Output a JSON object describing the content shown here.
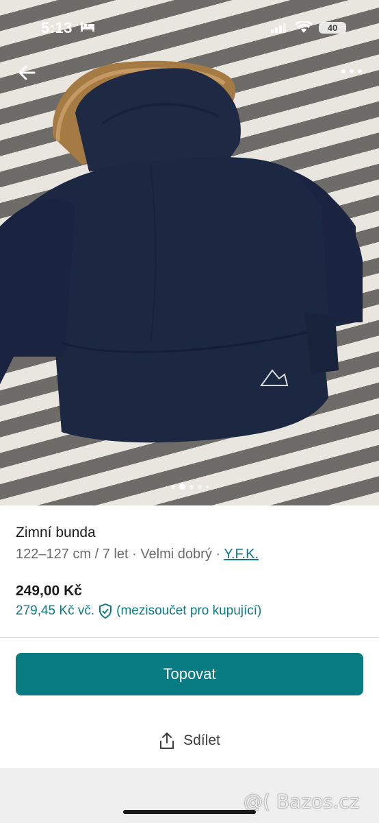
{
  "status_bar": {
    "time": "5:13",
    "battery": "40"
  },
  "photo": {
    "carousel_total": 5,
    "carousel_active_index": 1,
    "description_icon": "jacket-photo"
  },
  "listing": {
    "title": "Zimní bunda",
    "meta": "122–127 cm / 7 let · Velmi dobrý · ",
    "brand": "Y.F.K.",
    "price": "249,00 Kč",
    "price_total": "279,45 Kč vč.",
    "price_total_note": "(mezisoučet pro kupující)"
  },
  "actions": {
    "primary_label": "Topovat",
    "share_label": "Sdílet"
  },
  "watermark": "@( Bazos.cz",
  "colors": {
    "accent": "#087c82",
    "link": "#0c7a84"
  }
}
